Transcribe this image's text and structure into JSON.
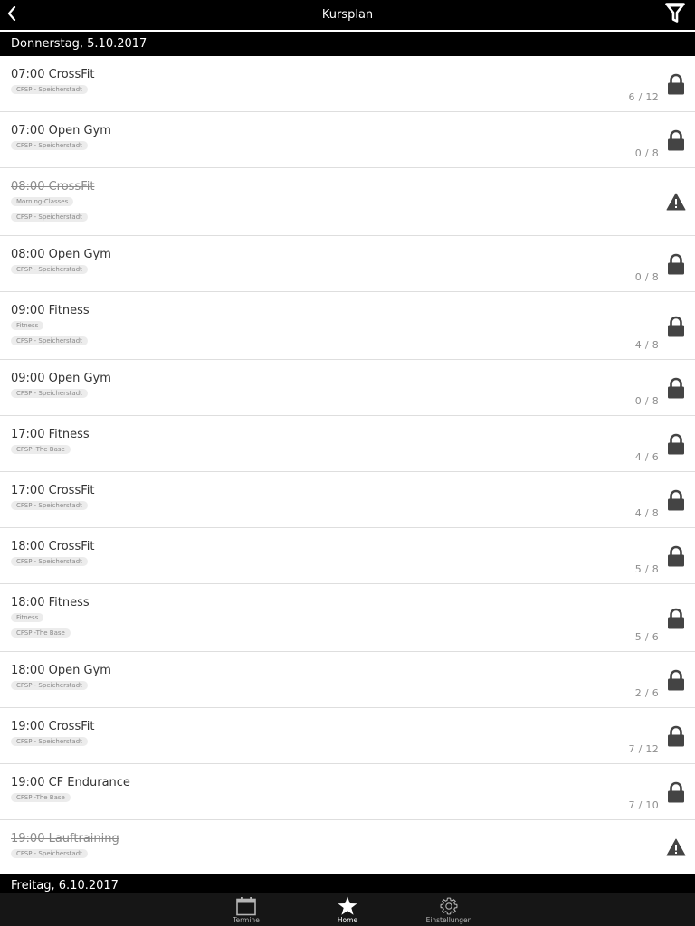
{
  "header": {
    "title": "Kursplan",
    "back_icon": "chevron-left-icon",
    "filter_icon": "filter-funnel-icon"
  },
  "days": [
    {
      "label": "Donnerstag, 5.10.2017",
      "courses": [
        {
          "title": "07:00 CrossFit",
          "tags": [
            "CFSP - Speicherstadt"
          ],
          "count": "6 / 12",
          "status": "locked",
          "cancelled": false
        },
        {
          "title": "07:00 Open Gym",
          "tags": [
            "CFSP - Speicherstadt"
          ],
          "count": "0 / 8",
          "status": "locked",
          "cancelled": false
        },
        {
          "title": "08:00 CrossFit",
          "tags": [
            "Morning-Classes",
            "CFSP - Speicherstadt"
          ],
          "count": "",
          "status": "warning",
          "cancelled": true
        },
        {
          "title": "08:00 Open Gym",
          "tags": [
            "CFSP - Speicherstadt"
          ],
          "count": "0 / 8",
          "status": "locked",
          "cancelled": false
        },
        {
          "title": "09:00 Fitness",
          "tags": [
            "Fitness",
            "CFSP - Speicherstadt"
          ],
          "count": "4 / 8",
          "status": "locked",
          "cancelled": false
        },
        {
          "title": "09:00 Open Gym",
          "tags": [
            "CFSP - Speicherstadt"
          ],
          "count": "0 / 8",
          "status": "locked",
          "cancelled": false
        },
        {
          "title": "17:00 Fitness",
          "tags": [
            "CFSP -The Base"
          ],
          "count": "4 / 6",
          "status": "locked",
          "cancelled": false
        },
        {
          "title": "17:00 CrossFit",
          "tags": [
            "CFSP - Speicherstadt"
          ],
          "count": "4 / 8",
          "status": "locked",
          "cancelled": false
        },
        {
          "title": "18:00 CrossFit",
          "tags": [
            "CFSP - Speicherstadt"
          ],
          "count": "5 / 8",
          "status": "locked",
          "cancelled": false
        },
        {
          "title": "18:00 Fitness",
          "tags": [
            "Fitness",
            "CFSP -The Base"
          ],
          "count": "5 / 6",
          "status": "locked",
          "cancelled": false
        },
        {
          "title": "18:00 Open Gym",
          "tags": [
            "CFSP - Speicherstadt"
          ],
          "count": "2 / 6",
          "status": "locked",
          "cancelled": false
        },
        {
          "title": "19:00 CrossFit",
          "tags": [
            "CFSP - Speicherstadt"
          ],
          "count": "7 / 12",
          "status": "locked",
          "cancelled": false
        },
        {
          "title": "19:00 CF Endurance",
          "tags": [
            "CFSP -The Base"
          ],
          "count": "7 / 10",
          "status": "locked",
          "cancelled": false
        },
        {
          "title": "19:00 Lauftraining",
          "tags": [
            "CFSP - Speicherstadt"
          ],
          "count": "",
          "status": "warning",
          "cancelled": true
        }
      ]
    },
    {
      "label": "Freitag, 6.10.2017",
      "courses": []
    }
  ],
  "tabbar": {
    "tabs": [
      {
        "label": "Termine",
        "icon": "calendar-icon",
        "active": false
      },
      {
        "label": "Home",
        "icon": "star-icon",
        "active": true
      },
      {
        "label": "Einstellungen",
        "icon": "gear-icon",
        "active": false
      }
    ]
  },
  "colors": {
    "bar": "#000000",
    "tabbar": "#161616",
    "text": "#333333",
    "muted": "#8e8e8e",
    "icon": "#444444",
    "tag_bg": "#ececec",
    "divider": "#dedede"
  }
}
